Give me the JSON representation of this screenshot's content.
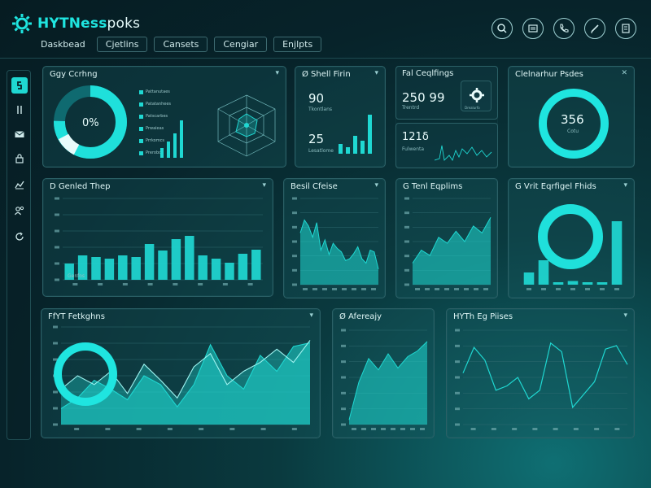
{
  "brand": {
    "prefix": "HYTNess",
    "suffix": "poks"
  },
  "nav": {
    "tabs": [
      "Daskbead",
      "Cjetlins",
      "Cansets",
      "Cengiar",
      "Enjlpts"
    ]
  },
  "top_icons": [
    "search-icon",
    "menu-icon",
    "phone-icon",
    "edit-icon",
    "calculator-icon"
  ],
  "sidebar": {
    "items": [
      "app-icon",
      "pause-icon",
      "mail-icon",
      "lock-icon",
      "chart-icon",
      "group-icon",
      "refresh-icon"
    ]
  },
  "colors": {
    "accent": "#1fd8d2",
    "panel_border": "#2b6066",
    "background": "#07232a"
  },
  "panels": {
    "p1": {
      "title": "Ggy Ccrhng",
      "center_value": "0%",
      "legend": [
        "Pattanutaes",
        "Patatanhees",
        "Patscarbes",
        "Prwaieas",
        "Prrkomcs",
        "Prerobos"
      ]
    },
    "p2": {
      "title": "Ø Shell Firin",
      "v1": "90",
      "v2": "25",
      "sub1": "Tkontlans",
      "sub2": "Lesatlome"
    },
    "p3": {
      "title": "Fal Ceqlfings",
      "v1": "250 99",
      "v2": "121δ",
      "sub1": "Trentrd",
      "sub2": "Drealurfo",
      "sub3": "Fulwenta"
    },
    "p4": {
      "title": "Clelnarhur Psdes",
      "value": "356",
      "sub": "Cotu"
    },
    "p5": {
      "title": "D Genled Thep",
      "legend": "Genfos"
    },
    "p6": {
      "title": "Besil Cfeise"
    },
    "p7": {
      "title": "G Tenl Eqplims"
    },
    "p8": {
      "title": "G Vrit Eqrfigel Fhids"
    },
    "p9": {
      "title": "FfYT Fetkghns"
    },
    "p10": {
      "title": "Ø Afereajy"
    },
    "p11": {
      "title": "HYTh Eg Piises"
    }
  },
  "chart_data": [
    {
      "type": "bar",
      "title": "D Genled Thep",
      "ylim": [
        0,
        100
      ],
      "values": [
        20,
        30,
        28,
        26,
        30,
        28,
        44,
        36,
        50,
        54,
        30,
        26,
        21,
        32,
        37
      ]
    },
    {
      "type": "area",
      "title": "Besil Cfeise",
      "values": [
        60,
        75,
        68,
        55,
        72,
        40,
        52,
        35,
        48,
        42,
        38,
        28,
        30,
        36,
        44,
        30,
        25,
        40,
        38,
        18
      ]
    },
    {
      "type": "area",
      "title": "G Tenl Eqplims",
      "values": [
        25,
        40,
        34,
        55,
        48,
        62,
        50,
        68,
        60,
        78
      ]
    },
    {
      "type": "bar",
      "title": "G Vrit Eqrfigel Fhids",
      "values": [
        10,
        20,
        2,
        3,
        2,
        2,
        52
      ]
    },
    {
      "type": "area",
      "title": "FfYT Fetkghns",
      "series": [
        {
          "values": [
            18,
            30,
            50,
            40,
            28,
            55,
            45,
            20,
            45,
            90,
            55,
            40,
            78,
            60,
            88,
            92
          ]
        },
        {
          "values": [
            40,
            55,
            45,
            60,
            35,
            68,
            50,
            30,
            65,
            80,
            45,
            60,
            70,
            85,
            70,
            95
          ]
        }
      ]
    },
    {
      "type": "area",
      "title": "Ø Afereajy",
      "values": [
        5,
        45,
        70,
        58,
        75,
        60,
        72,
        78,
        88
      ]
    },
    {
      "type": "line",
      "title": "HYTh Eg Piises",
      "values": [
        60,
        90,
        75,
        40,
        45,
        55,
        30,
        40,
        95,
        85,
        20,
        35,
        50,
        88,
        92,
        70
      ]
    }
  ]
}
